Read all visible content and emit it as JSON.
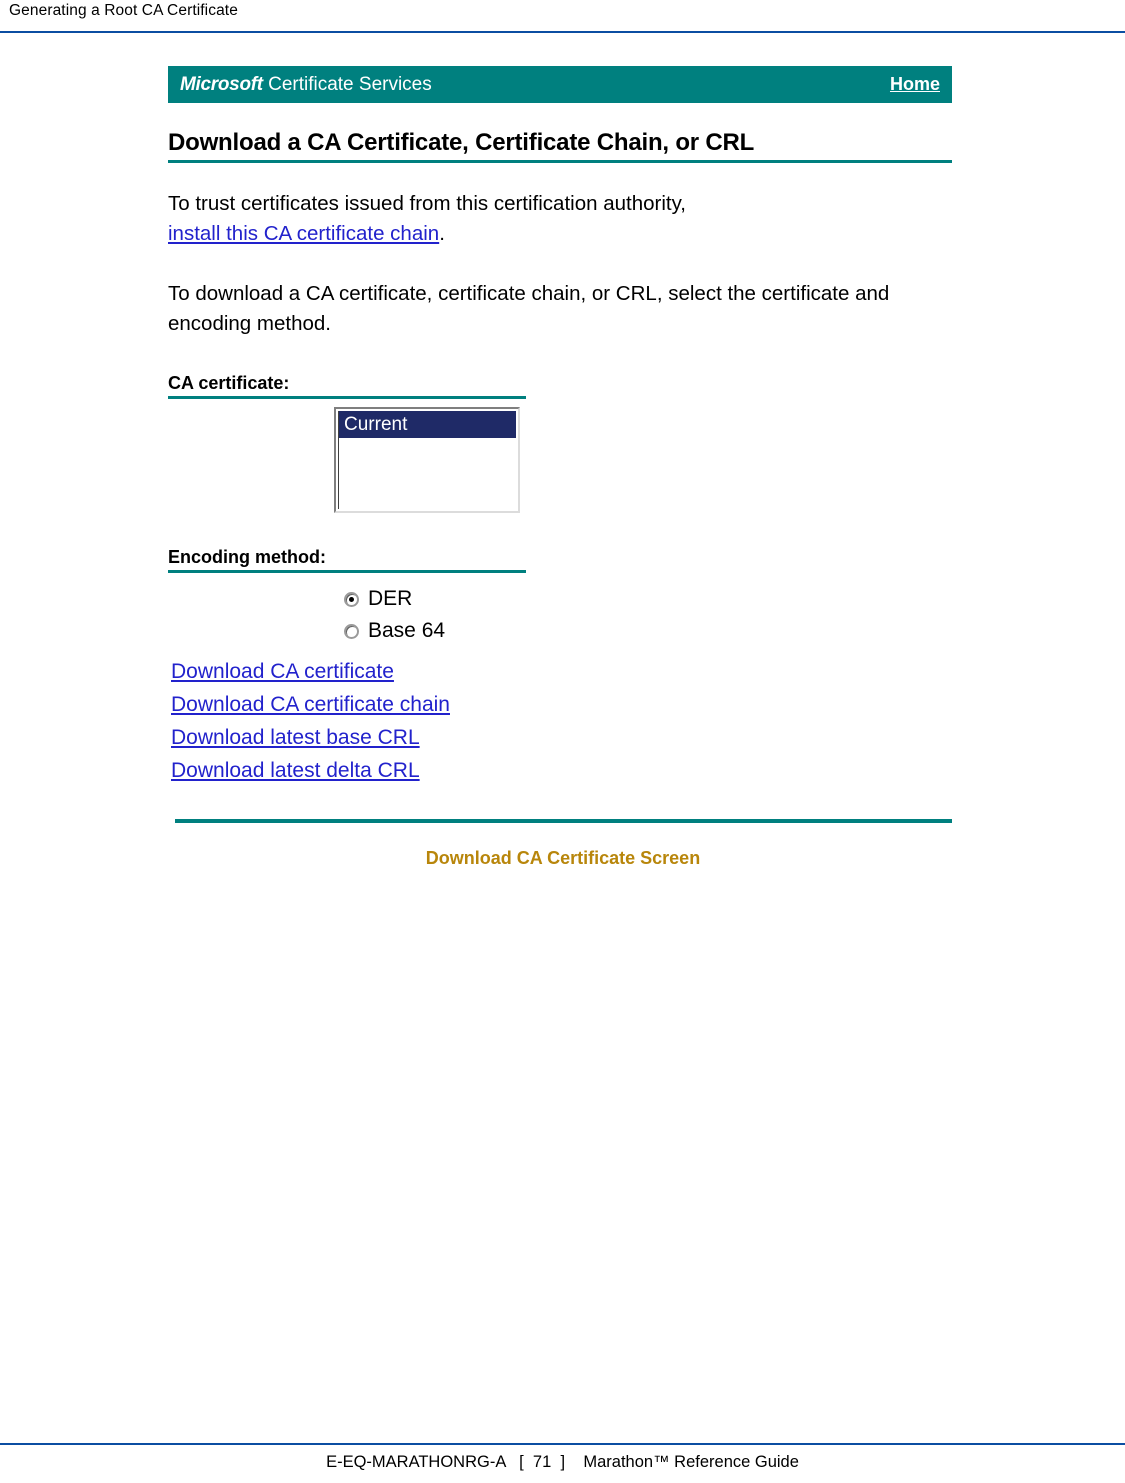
{
  "page": {
    "running_head": "Generating a Root CA Certificate",
    "header_rule_color": "#0B4EA2",
    "footer_rule_color": "#0B4EA2",
    "footer_text": "E-EQ-MARATHONRG-A   [  71  ]    Marathon™ Reference Guide",
    "caption": "Download CA Certificate Screen",
    "caption_color": "#B8860B"
  },
  "screenshot": {
    "banner": {
      "brand_bold": "Microsoft",
      "brand_rest": " Certificate Services",
      "home_link": "Home",
      "background_color": "#00807F",
      "text_color": "#FFFFFF"
    },
    "heading": "Download a CA Certificate, Certificate Chain, or CRL",
    "rule_color": "#00807F",
    "paragraph_1": {
      "before_link": "To trust certificates issued from this certification authority,",
      "link": "install this CA certificate chain",
      "after_link": "."
    },
    "paragraph_2": "To download a CA certificate, certificate chain, or CRL, select the certificate and encoding method.",
    "ca_certificate": {
      "label": "CA certificate:",
      "options": [
        {
          "label": "Current",
          "selected": true
        }
      ],
      "selected_background": "#1F2A67",
      "selected_text_color": "#FFFFFF"
    },
    "encoding_method": {
      "label": "Encoding method:",
      "options": [
        {
          "label": "DER",
          "selected": true
        },
        {
          "label": "Base 64",
          "selected": false
        }
      ]
    },
    "download_links": [
      "Download CA certificate",
      "Download CA certificate chain",
      "Download latest base CRL",
      "Download latest delta CRL"
    ],
    "link_color": "#2222CC"
  }
}
